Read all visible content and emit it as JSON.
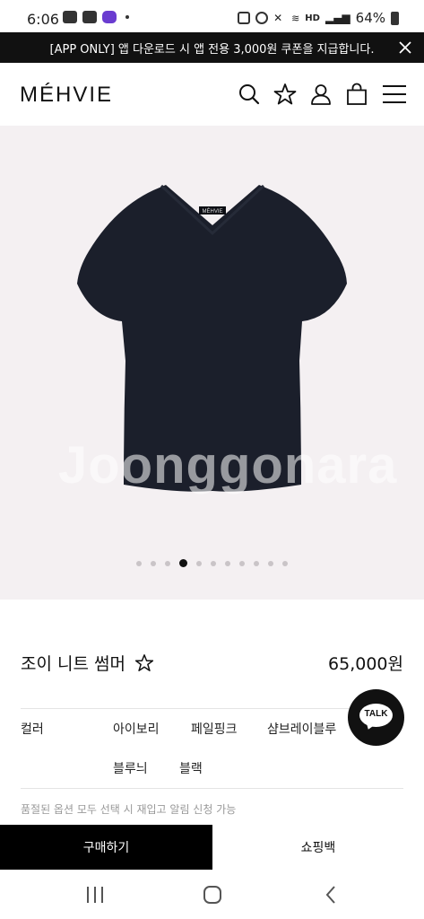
{
  "status": {
    "time": "6:06",
    "battery": "64%"
  },
  "promo": {
    "text": "[APP ONLY] 앱 다운로드 시 앱 전용 3,000원 쿠폰을 지급합니다."
  },
  "brand": {
    "logo": "MÉHVIE"
  },
  "hero": {
    "watermark": "Joonggonara",
    "garment_label": "MÉHVIE",
    "dot_count": 11,
    "active_dot": 3
  },
  "product": {
    "name": "조이 니트 썸머",
    "price": "65,000원"
  },
  "options": {
    "label": "컬러",
    "colors": [
      "아이보리",
      "페일핑크",
      "샴브레이블루",
      "블루늬",
      "블랙"
    ]
  },
  "notice": "품절된 옵션 모두 선택 시 재입고 알림 신청 가능",
  "talk": {
    "label": "TALK"
  },
  "actions": {
    "buy": "구매하기",
    "bag": "쇼핑백"
  },
  "colors": {
    "garment": "#1b1f2b",
    "hero_bg": "#f4f0f2",
    "bar": "#111111"
  }
}
